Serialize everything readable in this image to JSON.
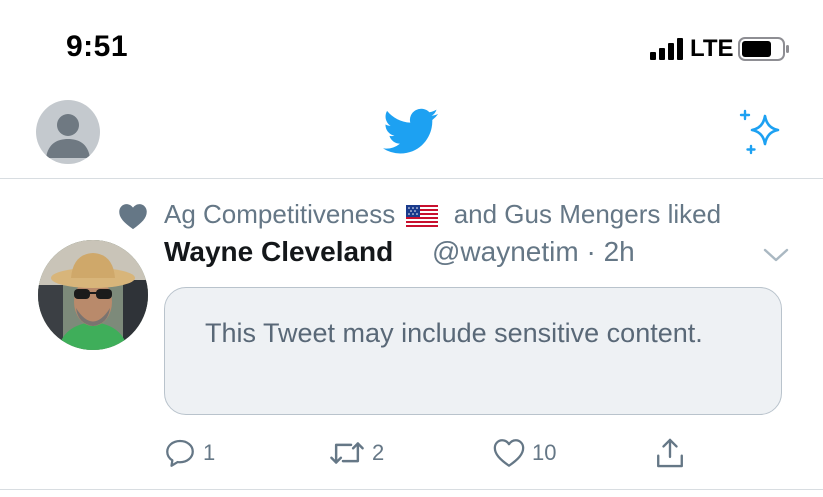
{
  "status_bar": {
    "time": "9:51",
    "network": "LTE",
    "icons": [
      "signal-bars-icon",
      "battery-icon"
    ]
  },
  "nav": {
    "icons": [
      "profile-avatar",
      "twitter-bird-icon",
      "sparkle-icon"
    ],
    "colors": {
      "brand": "#1da1f2"
    }
  },
  "tweet": {
    "social_context": {
      "icon": "heart-icon",
      "first_liker": "Ag Competitiveness",
      "flag_icon": "us-flag-icon",
      "rest": "and Gus Mengers liked"
    },
    "author": {
      "name": "Wayne Cleveland",
      "handle": "@waynetim",
      "separator": "·",
      "time": "2h"
    },
    "sensitive_notice": "This Tweet may include sensitive content.",
    "actions": {
      "reply_count": "1",
      "retweet_count": "2",
      "like_count": "10"
    }
  }
}
